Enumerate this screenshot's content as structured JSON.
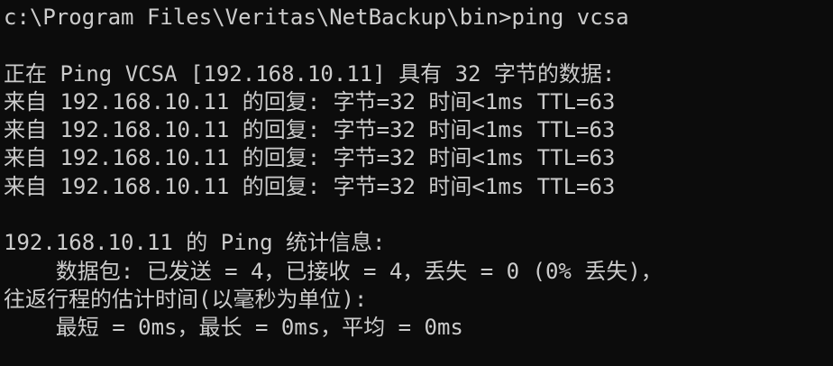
{
  "console": {
    "prompt_line": "c:\\Program Files\\Veritas\\NetBackup\\bin>ping vcsa",
    "blank_1": "",
    "pinging": "正在 Ping VCSA [192.168.10.11] 具有 32 字节的数据:",
    "replies": [
      "来自 192.168.10.11 的回复: 字节=32 时间<1ms TTL=63",
      "来自 192.168.10.11 的回复: 字节=32 时间<1ms TTL=63",
      "来自 192.168.10.11 的回复: 字节=32 时间<1ms TTL=63",
      "来自 192.168.10.11 的回复: 字节=32 时间<1ms TTL=63"
    ],
    "blank_2": "",
    "stats_header": "192.168.10.11 的 Ping 统计信息:",
    "packets": "    数据包: 已发送 = 4，已接收 = 4，丢失 = 0 (0% 丢失)，",
    "rtt_header": "往返行程的估计时间(以毫秒为单位):",
    "rtt_values": "    最短 = 0ms，最长 = 0ms，平均 = 0ms"
  }
}
